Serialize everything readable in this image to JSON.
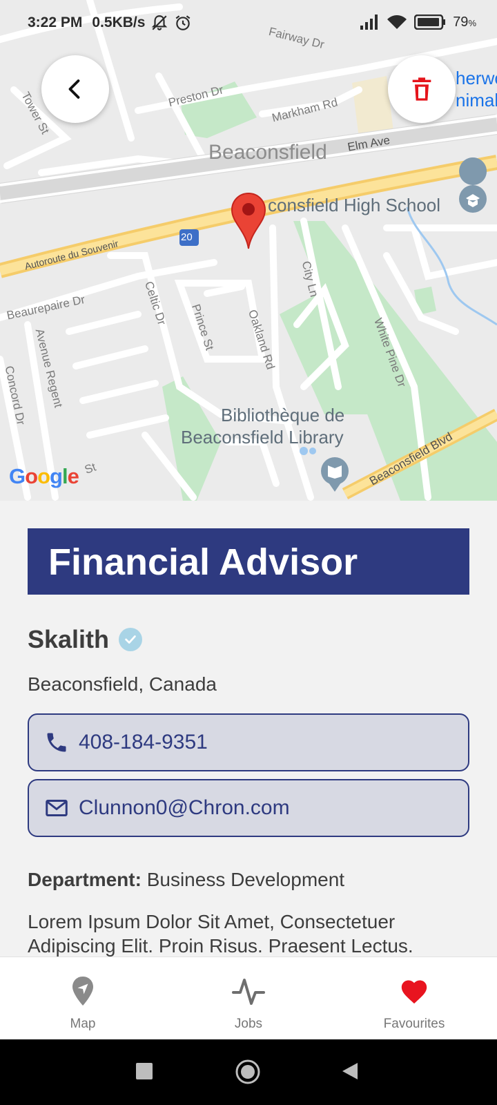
{
  "status_bar": {
    "time": "3:22 PM",
    "speed": "0.5KB/s",
    "battery": "79",
    "battery_unit": "%"
  },
  "map": {
    "labels": {
      "fairway": "Fairway Dr",
      "preston": "Preston Dr",
      "tower": "Tower St",
      "markham": "Markham Rd",
      "beaconsfield": "Beaconsfield",
      "elm": "Elm Ave",
      "school": "consfield High School",
      "souvenir": "Autoroute du Souvenir",
      "highway_num": "20",
      "beaurepaire": "Beaurepaire Dr",
      "celtic": "Celtic Dr",
      "prince": "Prince St",
      "oakland": "Oakland Rd",
      "city": "City Ln",
      "whitepine": "White Pine Dr",
      "regent": "Avenue Regent",
      "concord": "Concord Dr",
      "library1": "Bibliothèque de",
      "library2": "Beaconsfield Library",
      "boulevard": "Beaconsfield Blvd",
      "cst": "St",
      "sherwood1": "herwo",
      "sherwood2": "nimal",
      "google": "Google"
    }
  },
  "job": {
    "title": "Financial Advisor",
    "company": "Skalith",
    "location": "Beaconsfield, Canada",
    "phone": "408-184-9351",
    "email": "Clunnon0@Chron.com",
    "department_label": "Department:",
    "department_value": "Business Development",
    "description": "Lorem Ipsum Dolor Sit Amet, Consectetuer Adipiscing Elit. Proin Risus. Praesent Lectus."
  },
  "bottom_nav": {
    "map": "Map",
    "jobs": "Jobs",
    "favourites": "Favourites"
  },
  "colors": {
    "primary": "#2e3a80",
    "favourite": "#e8141f",
    "delete": "#e5141b",
    "pin": "#ea4335"
  }
}
